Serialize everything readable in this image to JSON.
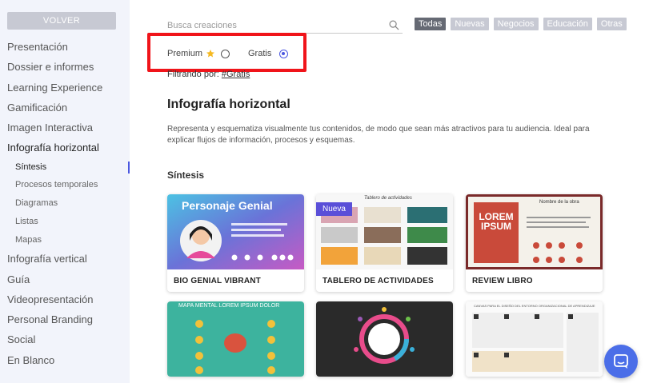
{
  "sidebar": {
    "back_label": "VOLVER",
    "items": [
      {
        "label": "Presentación"
      },
      {
        "label": "Dossier e informes"
      },
      {
        "label": "Learning Experience"
      },
      {
        "label": "Gamificación"
      },
      {
        "label": "Imagen Interactiva"
      },
      {
        "label": "Infografía horizontal"
      }
    ],
    "subitems": [
      {
        "label": "Síntesis"
      },
      {
        "label": "Procesos temporales"
      },
      {
        "label": "Diagramas"
      },
      {
        "label": "Listas"
      },
      {
        "label": "Mapas"
      }
    ],
    "items_after": [
      {
        "label": "Infografía vertical"
      },
      {
        "label": "Guía"
      },
      {
        "label": "Videopresentación"
      },
      {
        "label": "Personal Branding"
      },
      {
        "label": "Social"
      },
      {
        "label": "En Blanco"
      }
    ]
  },
  "search": {
    "placeholder": "Busca creaciones"
  },
  "filter_tags": [
    "Todas",
    "Nuevas",
    "Negocios",
    "Educación",
    "Otras"
  ],
  "price_filter": {
    "premium_label": "Premium",
    "free_label": "Gratis",
    "selected": "Gratis"
  },
  "filtering": {
    "prefix": "Filtrando por:",
    "tag": "#Gratis"
  },
  "main": {
    "title": "Infografía horizontal",
    "description": "Representa y esquematiza visualmente tus contenidos, de modo que sean más atractivos para tu audiencia. Ideal para explicar flujos de información, procesos y esquemas.",
    "section_title": "Síntesis"
  },
  "cards": [
    {
      "label": "BIO GENIAL VIBRANT",
      "thumb_title": "Personaje Genial"
    },
    {
      "label": "TABLERO DE ACTIVIDADES",
      "badge": "Nueva",
      "thumb_title": "Tablero de actividades"
    },
    {
      "label": "REVIEW LIBRO",
      "thumb_title": "LOREM IPSUM",
      "thumb_sub": "Nombre de la obra"
    },
    {
      "label": "",
      "thumb_title": "MAPA MENTAL LOREM IPSUM DOLOR"
    },
    {
      "label": "",
      "thumb_title": ""
    },
    {
      "label": "",
      "thumb_title": "CANVAS PARA EL DISEÑO DEL ENTORNO ORGANIZACIONAL DE APRENDIZAJE"
    }
  ],
  "colors": {
    "accent": "#4b57e0",
    "highlight": "#f0141a",
    "sidebar_bg": "#f2f4fb"
  }
}
